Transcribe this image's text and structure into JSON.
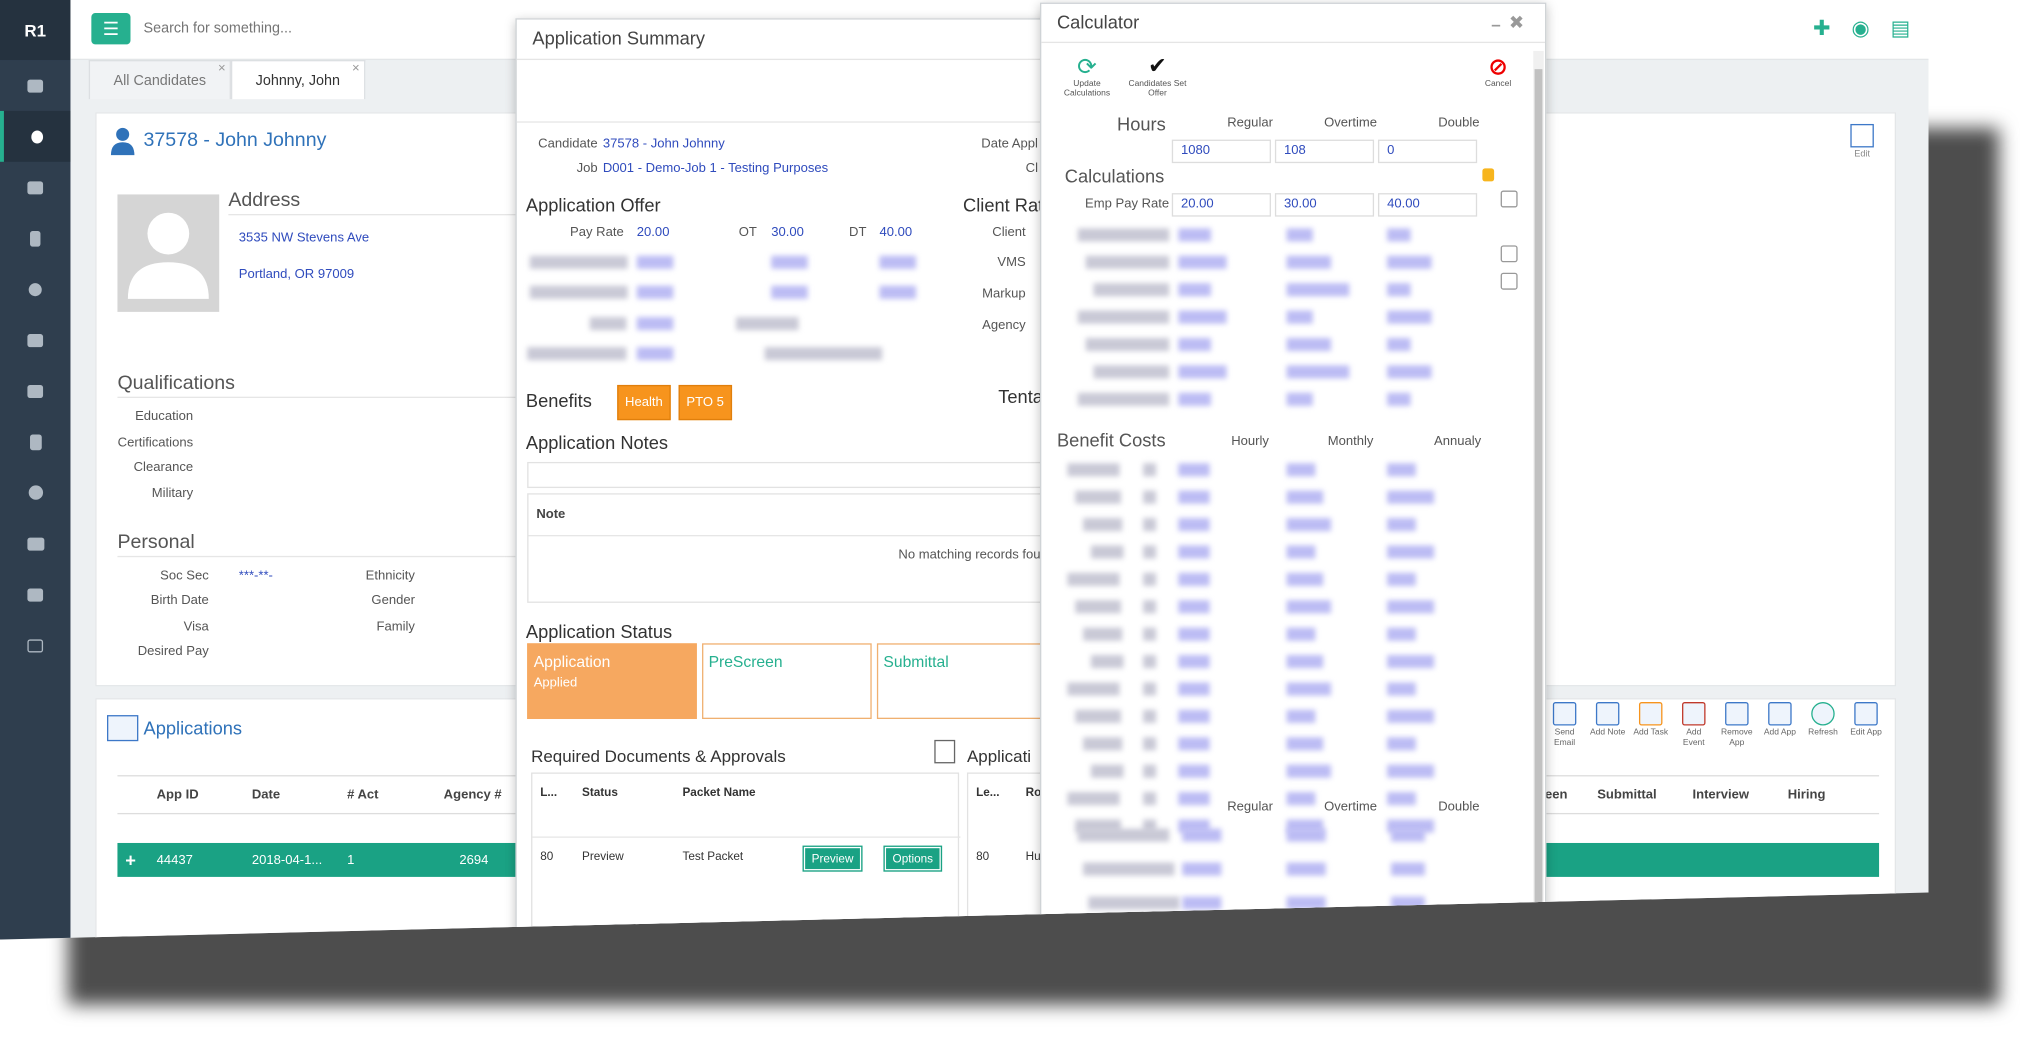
{
  "sidebar": {
    "logo": "R1"
  },
  "topbar": {
    "search_placeholder": "Search for something..."
  },
  "tabs": [
    {
      "label": "All Candidates"
    },
    {
      "label": "Johnny, John"
    }
  ],
  "candidate": {
    "title": "37578 - John Johnny",
    "edit_label": "Edit",
    "address_title": "Address",
    "address_line1": "3535 NW Stevens Ave",
    "address_line2": "Portland, OR 97009",
    "qualifications_title": "Qualifications",
    "education": "Education",
    "certifications": "Certifications",
    "clearance": "Clearance",
    "military": "Military",
    "personal_title": "Personal",
    "soc_sec": "Soc Sec",
    "soc_sec_value": "***-**-",
    "birth_date": "Birth Date",
    "visa": "Visa",
    "desired_pay": "Desired Pay",
    "ethnicity": "Ethnicity",
    "gender": "Gender",
    "family": "Family"
  },
  "applications": {
    "title": "Applications",
    "columns": [
      "App ID",
      "Date",
      "# Act",
      "Agency #"
    ],
    "right_columns": [
      "een",
      "Submittal",
      "Interview",
      "Hiring"
    ],
    "row": {
      "app_id": "44437",
      "date": "2018-04-1...",
      "act": "1",
      "agency": "2694"
    },
    "tools": [
      {
        "label": "Send Email"
      },
      {
        "label": "Add Note"
      },
      {
        "label": "Add Task"
      },
      {
        "label": "Add Event"
      },
      {
        "label": "Remove App"
      },
      {
        "label": "Add App"
      },
      {
        "label": "Refresh"
      },
      {
        "label": "Edit App"
      }
    ]
  },
  "summary": {
    "title": "Application Summary",
    "candidate_label": "Candidate",
    "candidate_value": "37578 - John Johnny",
    "job_label": "Job",
    "job_value": "D001 - Demo-Job 1 - Testing Purposes",
    "date_applied_label": "Date Appl",
    "cl_label": "Cl",
    "offer_title": "Application Offer",
    "pay_rate_label": "Pay Rate",
    "pay_rate": "20.00",
    "ot_label": "OT",
    "ot": "30.00",
    "dt_label": "DT",
    "dt": "40.00",
    "client_rate_title": "Client Rat",
    "client_label": "Client",
    "vms_label": "VMS",
    "markup_label": "Markup",
    "agency_label": "Agency",
    "benefits_title": "Benefits",
    "benefit_1": "Health",
    "benefit_2": "PTO 5",
    "tenta": "Tenta",
    "notes_title": "Application Notes",
    "note_header": "Note",
    "no_records": "No matching records foun",
    "status_title": "Application Status",
    "status_1": "Application",
    "status_1_sub": "Applied",
    "status_2": "PreScreen",
    "status_3": "Submittal",
    "req_docs_title": "Required Documents & Approvals",
    "applicati": "Applicati",
    "docs_columns": [
      "L...",
      "Status",
      "Packet Name"
    ],
    "docs_row": {
      "l": "80",
      "status": "Preview",
      "packet": "Test Packet"
    },
    "preview_btn": "Preview",
    "options_btn": "Options",
    "right_cols": [
      "Le...",
      "Ro"
    ],
    "right_row": {
      "le": "80",
      "ro": "Hu"
    }
  },
  "calculator": {
    "title": "Calculator",
    "update_label": "Update Calculations",
    "set_offer_label": "Candidates Set Offer",
    "cancel_label": "Cancel",
    "hours_title": "Hours",
    "regular": "Regular",
    "overtime": "Overtime",
    "double": "Double",
    "hours_regular": "1080",
    "hours_overtime": "108",
    "hours_double": "0",
    "calc_title": "Calculations",
    "emp_pay_label": "Emp Pay Rate",
    "emp_regular": "20.00",
    "emp_overtime": "30.00",
    "emp_double": "40.00",
    "benefit_title": "Benefit Costs",
    "hourly": "Hourly",
    "monthly": "Monthly",
    "annualy": "Annualy",
    "bottom_regular": "Regular",
    "bottom_overtime": "Overtime",
    "bottom_double": "Double"
  },
  "colors": {
    "accent": "#26b08f",
    "sidebar": "#2f3e4e",
    "link": "#2f72b9",
    "orange": "#f7941d"
  }
}
